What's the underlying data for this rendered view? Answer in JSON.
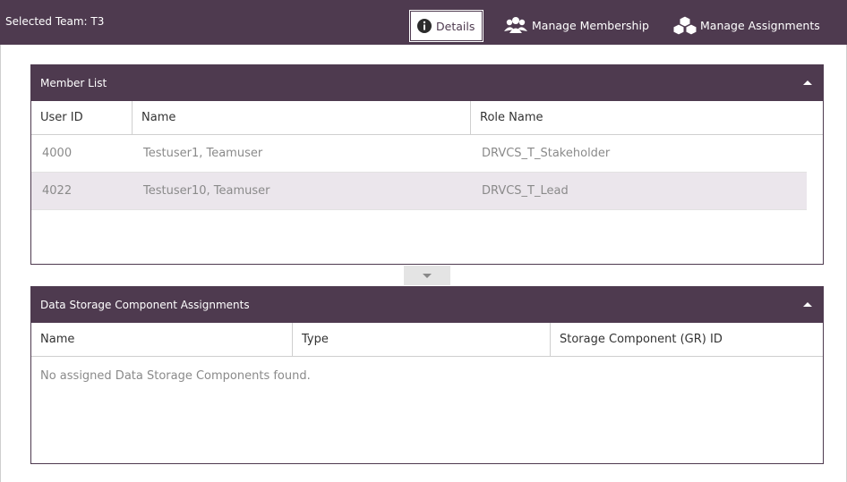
{
  "header": {
    "selected_team": "Selected Team: T3",
    "tabs": [
      {
        "label": "Details",
        "icon": "info-icon",
        "active": true
      },
      {
        "label": "Manage Membership",
        "icon": "users-icon",
        "active": false
      },
      {
        "label": "Manage Assignments",
        "icon": "cubes-icon",
        "active": false
      }
    ]
  },
  "member_list": {
    "title": "Member List",
    "columns": [
      "User ID",
      "Name",
      "Role Name"
    ],
    "rows": [
      {
        "user_id": "4000",
        "name": "Testuser1, Teamuser",
        "role": "DRVCS_T_Stakeholder"
      },
      {
        "user_id": "4022",
        "name": "Testuser10, Teamuser",
        "role": "DRVCS_T_Lead"
      }
    ]
  },
  "assignments": {
    "title": "Data Storage Component Assignments",
    "columns": [
      "Name",
      "Type",
      "Storage Component (GR) ID"
    ],
    "empty_message": "No assigned Data Storage Components found."
  },
  "colors": {
    "header_bg": "#4e3a4f",
    "selected_row_bg": "#ebe6ec"
  }
}
